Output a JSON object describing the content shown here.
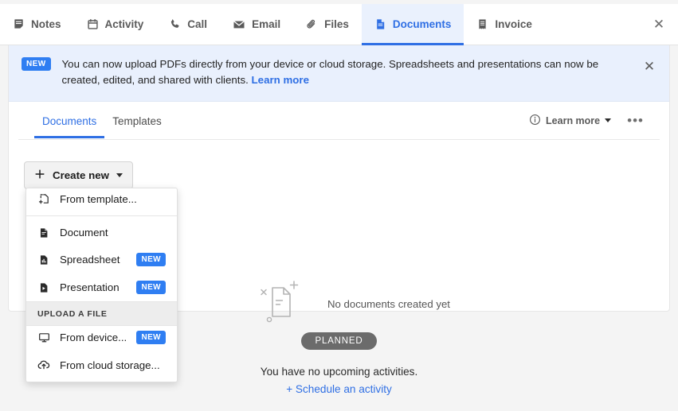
{
  "tabbar": {
    "tabs": [
      {
        "label": "Notes",
        "icon": "note-icon",
        "active": false
      },
      {
        "label": "Activity",
        "icon": "calendar-icon",
        "active": false
      },
      {
        "label": "Call",
        "icon": "phone-icon",
        "active": false
      },
      {
        "label": "Email",
        "icon": "envelope-icon",
        "active": false
      },
      {
        "label": "Files",
        "icon": "paperclip-icon",
        "active": false
      },
      {
        "label": "Documents",
        "icon": "document-icon",
        "active": true
      },
      {
        "label": "Invoice",
        "icon": "invoice-icon",
        "active": false
      }
    ],
    "close_label": "✕"
  },
  "banner": {
    "badge": "NEW",
    "text": "You can now upload PDFs directly from your device or cloud storage. Spreadsheets and presentations can now be created, edited, and shared with clients.",
    "link": "Learn more",
    "close_label": "✕",
    "background": "#e9f0fd",
    "accent": "#2f7ef2"
  },
  "subbar": {
    "tabs": [
      {
        "label": "Documents",
        "active": true
      },
      {
        "label": "Templates",
        "active": false
      }
    ],
    "learn_more": "Learn more",
    "overflow": "•••"
  },
  "create": {
    "plus": "+",
    "label": "Create new"
  },
  "menu": {
    "items": [
      {
        "label": "From template...",
        "icon": "template-add-icon",
        "badge": ""
      },
      {
        "label": "Document",
        "icon": "document-file-icon",
        "badge": ""
      },
      {
        "label": "Spreadsheet",
        "icon": "spreadsheet-icon",
        "badge": "NEW"
      },
      {
        "label": "Presentation",
        "icon": "presentation-icon",
        "badge": "NEW"
      }
    ],
    "group_label": "UPLOAD A FILE",
    "upload_items": [
      {
        "label": "From device...",
        "icon": "monitor-icon",
        "badge": "NEW"
      },
      {
        "label": "From cloud storage...",
        "icon": "cloud-upload-icon",
        "badge": ""
      }
    ]
  },
  "empty": {
    "text": "No documents created yet",
    "icon": "empty-document-icon"
  },
  "bottom": {
    "status": "PLANNED",
    "message": "You have no upcoming activities.",
    "action": "+ Schedule an activity",
    "pill_color": "#6b6b6b",
    "link_color": "#2f6fe4"
  }
}
